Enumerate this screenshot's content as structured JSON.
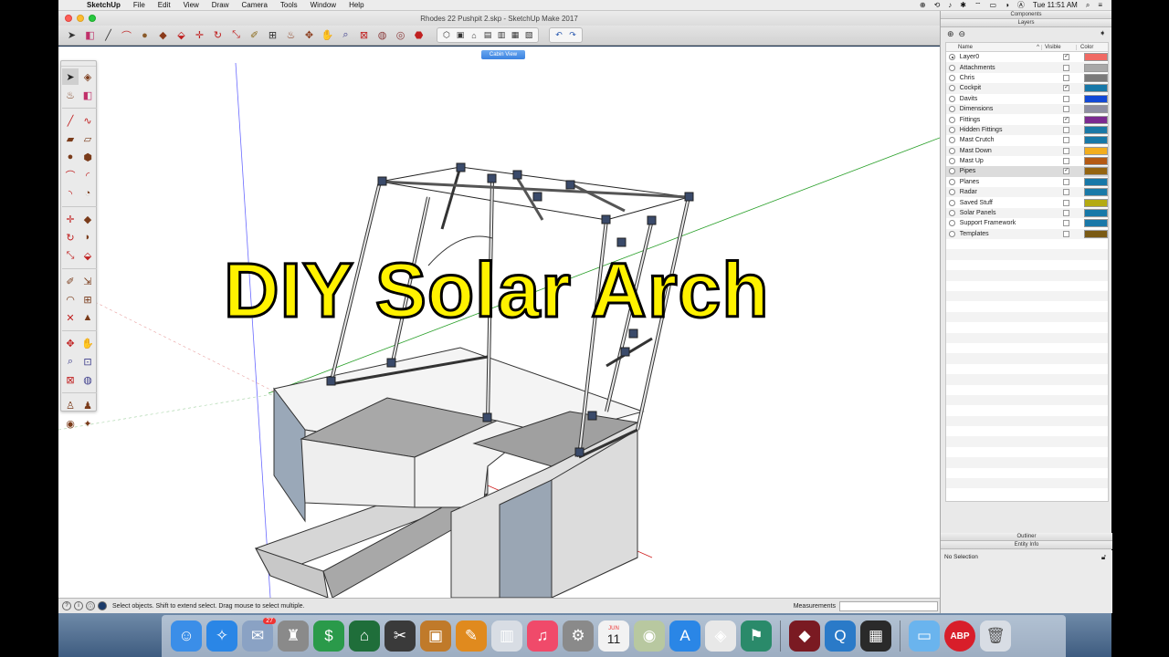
{
  "menubar": {
    "apple": "",
    "items": [
      "SketchUp",
      "File",
      "Edit",
      "View",
      "Draw",
      "Camera",
      "Tools",
      "Window",
      "Help"
    ],
    "clock": "Tue 11:51 AM",
    "status_icons": [
      "⊕",
      "⟲",
      "♪",
      "✱",
      "⌔",
      "▭",
      "◑",
      "Ⓐ",
      "⌕",
      "≡"
    ]
  },
  "window": {
    "title": "Rhodes 22 Pushpit 2.skp - SketchUp Make 2017"
  },
  "scene": {
    "tab_label": "Cabin View"
  },
  "headline": {
    "text": "DIY Solar Arch"
  },
  "status": {
    "message": "Select objects. Shift to extend select. Drag mouse to select multiple.",
    "measurements_label": "Measurements",
    "icons": [
      "?",
      "i",
      "ⓘ",
      "●"
    ]
  },
  "panel": {
    "components_header": "Components",
    "layers_header": "Layers",
    "col_name": "Name",
    "col_visible": "Visible",
    "col_color": "Color",
    "outliner_header": "Outliner",
    "entity_header": "Entity Info",
    "entity_text": "No Selection",
    "layers": [
      {
        "name": "Layer0",
        "visible": true,
        "active": true,
        "color": "#f06a64"
      },
      {
        "name": "Attachments",
        "visible": false,
        "active": false,
        "color": "#a8a8a8"
      },
      {
        "name": "Chris",
        "visible": false,
        "active": false,
        "color": "#7a7a7a"
      },
      {
        "name": "Cockpit",
        "visible": true,
        "active": false,
        "color": "#1778a8"
      },
      {
        "name": "Davits",
        "visible": false,
        "active": false,
        "color": "#1148d6"
      },
      {
        "name": "Dimensions",
        "visible": false,
        "active": false,
        "color": "#8e8ea2"
      },
      {
        "name": "Fittings",
        "visible": true,
        "active": false,
        "color": "#7b2a90"
      },
      {
        "name": "Hidden Fittings",
        "visible": false,
        "active": false,
        "color": "#1a78a6"
      },
      {
        "name": "Mast Crutch",
        "visible": false,
        "active": false,
        "color": "#1778a8"
      },
      {
        "name": "Mast Down",
        "visible": false,
        "active": false,
        "color": "#f2ad1e"
      },
      {
        "name": "Mast Up",
        "visible": false,
        "active": false,
        "color": "#b45a14"
      },
      {
        "name": "Pipes",
        "visible": true,
        "active": false,
        "color": "#946410",
        "selected": true
      },
      {
        "name": "Planes",
        "visible": false,
        "active": false,
        "color": "#1778a8"
      },
      {
        "name": "Radar",
        "visible": false,
        "active": false,
        "color": "#1a7aa8"
      },
      {
        "name": "Saved Stuff",
        "visible": false,
        "active": false,
        "color": "#b4aa12"
      },
      {
        "name": "Solar Panels",
        "visible": false,
        "active": false,
        "color": "#1778a8"
      },
      {
        "name": "Support Framework",
        "visible": false,
        "active": false,
        "color": "#1a78a8"
      },
      {
        "name": "Templates",
        "visible": false,
        "active": false,
        "color": "#7a5a14"
      }
    ]
  },
  "dock": {
    "calendar_month": "JUN",
    "calendar_day": "11",
    "mail_badge": "27",
    "adblock_label": "ABP",
    "apps": [
      {
        "name": "finder",
        "glyph": "☺",
        "color": "#3b8ee8"
      },
      {
        "name": "safari",
        "glyph": "✧",
        "color": "#2a86e6"
      },
      {
        "name": "mail-stamps",
        "glyph": "✉",
        "color": "#8aa2c4"
      },
      {
        "name": "automator",
        "glyph": "♜",
        "color": "#8a8a8a"
      },
      {
        "name": "money",
        "glyph": "$",
        "color": "#2a9a4a"
      },
      {
        "name": "banking",
        "glyph": "⌂",
        "color": "#1f6e3a"
      },
      {
        "name": "final-cut",
        "glyph": "✂",
        "color": "#3a3a3a"
      },
      {
        "name": "photos-viewer",
        "glyph": "▣",
        "color": "#c07a2a"
      },
      {
        "name": "pages",
        "glyph": "✎",
        "color": "#e08a1e"
      },
      {
        "name": "numbers",
        "glyph": "▥",
        "color": "#d8dde4"
      },
      {
        "name": "music",
        "glyph": "♫",
        "color": "#f04a6a"
      },
      {
        "name": "system-preferences",
        "glyph": "⚙",
        "color": "#8a8a8a"
      },
      {
        "name": "calendar",
        "glyph": "",
        "color": "#f2f2f2"
      },
      {
        "name": "maps",
        "glyph": "◉",
        "color": "#b8c8a0"
      },
      {
        "name": "app-store",
        "glyph": "A",
        "color": "#2a86e6"
      },
      {
        "name": "sketchup",
        "glyph": "◈",
        "color": "#e8e8e8"
      },
      {
        "name": "runner",
        "glyph": "⚑",
        "color": "#2a8a6a"
      }
    ],
    "apps_right": [
      {
        "name": "audio-tool",
        "glyph": "◆",
        "color": "#7a1a22"
      },
      {
        "name": "quicktime",
        "glyph": "Q",
        "color": "#2a7ac8"
      },
      {
        "name": "piano",
        "glyph": "▦",
        "color": "#2a2a2a"
      }
    ]
  }
}
